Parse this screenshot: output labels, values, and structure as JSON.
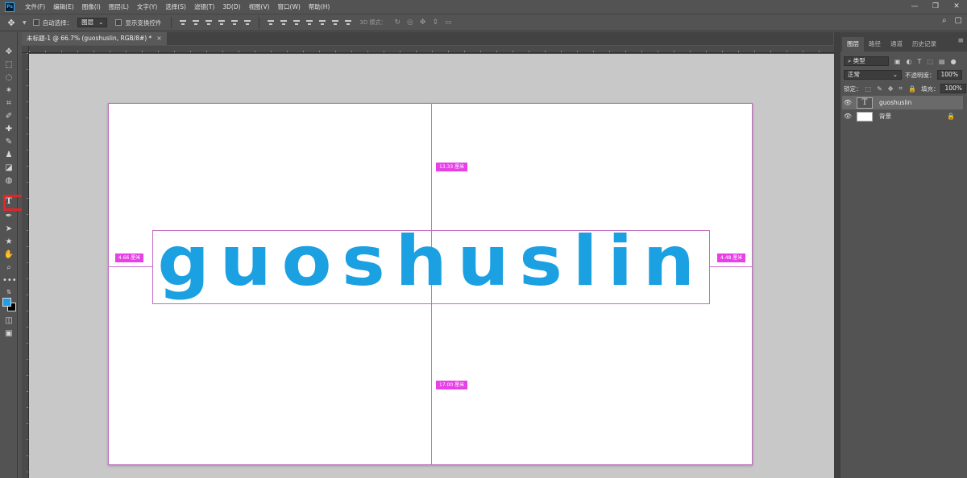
{
  "app": {
    "logo": "Ps"
  },
  "menu": [
    "文件(F)",
    "编辑(E)",
    "图像(I)",
    "图层(L)",
    "文字(Y)",
    "选择(S)",
    "滤镜(T)",
    "3D(D)",
    "视图(V)",
    "窗口(W)",
    "帮助(H)"
  ],
  "window_controls": [
    "—",
    "❐",
    "✕"
  ],
  "options": {
    "auto_select_label": "自动选择：",
    "auto_select_value": "图层",
    "show_transform_label": "显示变换控件",
    "mode_3d_label": "3D 模式："
  },
  "document_tab": {
    "title": "未标题-1 @ 66.7% (guoshuslin, RGB/8#) *",
    "close": "×"
  },
  "canvas": {
    "text": "guoshuslin",
    "text_color": "#1ba0e2",
    "guide_color": "#e640e6",
    "measurements": {
      "top": "13.33 厘米",
      "left": "4.66 厘米",
      "right": "4.48 厘米",
      "bottom": "17.00 厘米"
    }
  },
  "colors": {
    "foreground": "#1ea0e6",
    "background": "#000000",
    "highlight": "#e1262a"
  },
  "layers_panel": {
    "tabs": [
      "图层",
      "路径",
      "通道",
      "历史记录"
    ],
    "filter_label": "类型",
    "blend_mode": "正常",
    "opacity_label": "不透明度：",
    "opacity_value": "100%",
    "lock_label": "锁定：",
    "fill_label": "填充：",
    "fill_value": "100%",
    "layers": [
      {
        "name": "guoshuslin",
        "type": "text",
        "thumb": "T"
      },
      {
        "name": "背景",
        "type": "background"
      }
    ]
  }
}
